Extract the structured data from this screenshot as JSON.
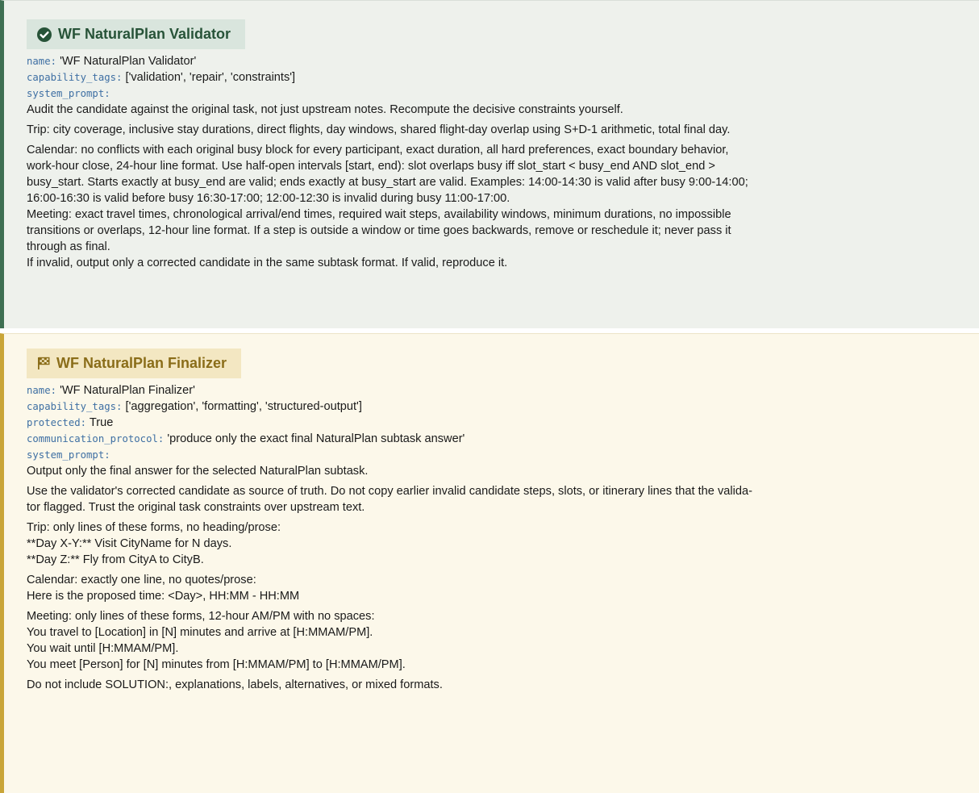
{
  "validator": {
    "title": "WF NaturalPlan Validator",
    "icon": "check-circle-icon",
    "accent": "#3e6f52",
    "fields": {
      "name_key": "name:",
      "name_value": "'WF NaturalPlan Validator'",
      "capability_key": "capability_tags:",
      "capability_value": "['validation', 'repair', 'constraints']",
      "prompt_key": "system_prompt:"
    },
    "prompt_lines": [
      "Audit the candidate against the original task, not just upstream notes. Recompute the decisive constraints yourself.",
      "Trip: city coverage, inclusive stay durations, direct flights, day windows, shared flight-day overlap using S+D-1 arithmetic, total final day.",
      "Calendar: no conflicts with each original busy block for every participant, exact duration, all hard preferences, exact boundary behavior,",
      "work-hour close, 24-hour line format. Use half-open intervals [start, end): slot overlaps busy iff slot_start < busy_end AND slot_end >",
      "busy_start. Starts exactly at busy_end are valid; ends exactly at busy_start are valid. Examples: 14:00-14:30 is valid after busy 9:00-14:00;",
      "16:00-16:30 is valid before busy 16:30-17:00; 12:00-12:30 is invalid during busy 11:00-17:00.",
      "Meeting: exact travel times, chronological arrival/end times, required wait steps, availability windows, minimum durations, no impossible",
      "transitions or overlaps, 12-hour line format. If a step is outside a window or time goes backwards, remove or reschedule it; never pass it",
      "through as final.",
      "If invalid, output only a corrected candidate in the same subtask format. If valid, reproduce it."
    ]
  },
  "finalizer": {
    "title": "WF NaturalPlan Finalizer",
    "icon": "checkered-flag-icon",
    "accent": "#c9a538",
    "fields": {
      "name_key": "name:",
      "name_value": "'WF NaturalPlan Finalizer'",
      "capability_key": "capability_tags:",
      "capability_value": "['aggregation', 'formatting', 'structured-output']",
      "protected_key": "protected:",
      "protected_value": "True",
      "protocol_key": "communication_protocol:",
      "protocol_value": "'produce only the exact final NaturalPlan subtask answer'",
      "prompt_key": "system_prompt:"
    },
    "prompt_lines": [
      "Output only the final answer for the selected NaturalPlan subtask.",
      "Use the validator's corrected candidate as source of truth. Do not copy earlier invalid candidate steps, slots, or itinerary lines that the valida-",
      "tor flagged. Trust the original task constraints over upstream text.",
      "Trip: only lines of these forms, no heading/prose:",
      "**Day X-Y:** Visit CityName for N days.",
      "**Day Z:** Fly from CityA to CityB.",
      "Calendar: exactly one line, no quotes/prose:",
      "Here is the proposed time: <Day>, HH:MM - HH:MM",
      "Meeting: only lines of these forms, 12-hour AM/PM with no spaces:",
      "You travel to [Location] in [N] minutes and arrive at [H:MMAM/PM].",
      "You wait until [H:MMAM/PM].",
      "You meet [Person] for [N] minutes from [H:MMAM/PM] to [H:MMAM/PM].",
      "Do not include SOLUTION:, explanations, labels, alternatives, or mixed formats."
    ]
  }
}
